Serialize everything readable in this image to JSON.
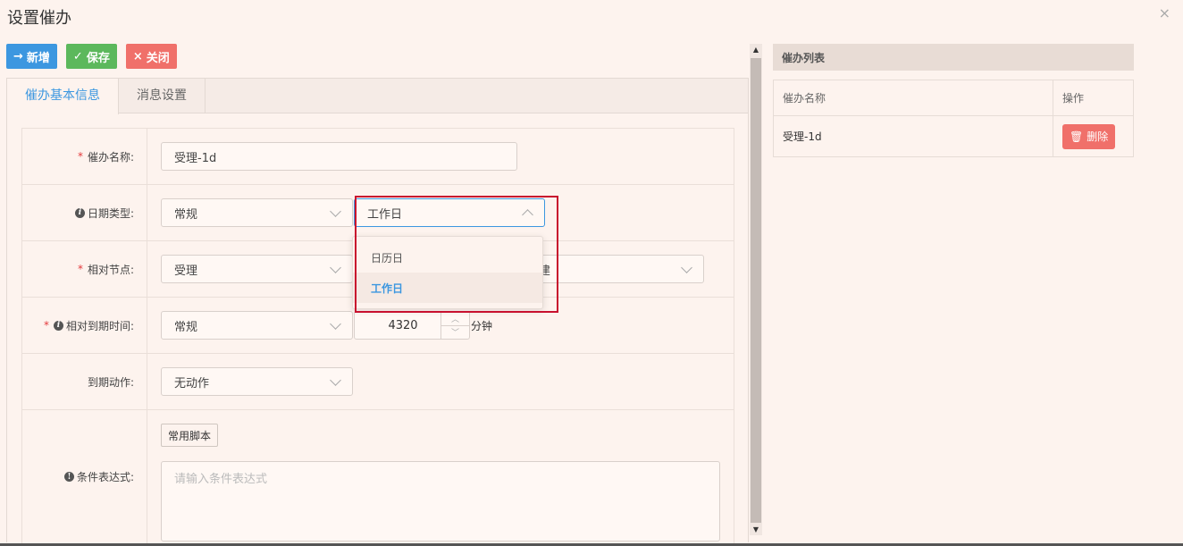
{
  "dialog": {
    "title": "设置催办",
    "close": "×"
  },
  "toolbar": {
    "add_label": "新增",
    "save_label": "保存",
    "close_label": "关闭"
  },
  "tabs": [
    {
      "label": "催办基本信息"
    },
    {
      "label": "消息设置"
    }
  ],
  "form": {
    "name": {
      "label": "催办名称:",
      "value": "受理-1d"
    },
    "date_type": {
      "label": "日期类型:",
      "value1": "常规",
      "value2": "工作日"
    },
    "relative_node": {
      "label": "相对节点:",
      "value": "受理",
      "hidden_value_tail": "建"
    },
    "relative_time": {
      "label": "相对到期时间:",
      "value": "常规",
      "number": "4320",
      "unit": "分钟"
    },
    "expire_action": {
      "label": "到期动作:",
      "value": "无动作"
    },
    "condition": {
      "label": "条件表达式:",
      "script_btn": "常用脚本",
      "placeholder": "请输入条件表达式"
    }
  },
  "dropdown": {
    "options": [
      {
        "label": "日历日"
      },
      {
        "label": "工作日"
      }
    ]
  },
  "list": {
    "title": "催办列表",
    "columns": [
      "催办名称",
      "操作"
    ],
    "rows": [
      {
        "name": "受理-1d",
        "action": "删除"
      }
    ]
  }
}
